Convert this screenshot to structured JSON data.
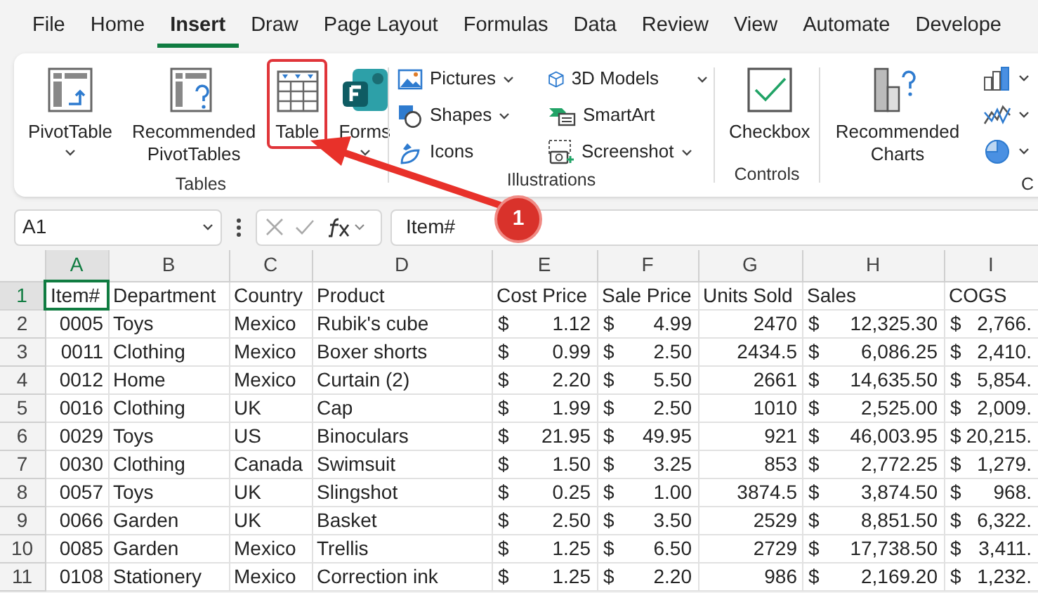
{
  "ribbon_tabs": [
    {
      "label": "File",
      "selected": false
    },
    {
      "label": "Home",
      "selected": false
    },
    {
      "label": "Insert",
      "selected": true
    },
    {
      "label": "Draw",
      "selected": false
    },
    {
      "label": "Page Layout",
      "selected": false
    },
    {
      "label": "Formulas",
      "selected": false
    },
    {
      "label": "Data",
      "selected": false
    },
    {
      "label": "Review",
      "selected": false
    },
    {
      "label": "View",
      "selected": false
    },
    {
      "label": "Automate",
      "selected": false
    },
    {
      "label": "Develope",
      "selected": false
    }
  ],
  "ribbon_groups": [
    {
      "label": "Tables",
      "buttons": [
        {
          "kind": "large",
          "label": "PivotTable",
          "dropdown": true,
          "highlighted": false
        },
        {
          "kind": "large",
          "label": "Recommended PivotTables",
          "dropdown": false,
          "highlighted": false
        },
        {
          "kind": "large",
          "label": "Table",
          "dropdown": false,
          "highlighted": true
        },
        {
          "kind": "large",
          "label": "Forms",
          "dropdown": true,
          "highlighted": false
        }
      ]
    },
    {
      "label": "Illustrations",
      "buttons": [
        {
          "kind": "small",
          "label": "Pictures",
          "dropdown": true,
          "highlighted": false
        },
        {
          "kind": "small",
          "label": "Shapes",
          "dropdown": true,
          "highlighted": false
        },
        {
          "kind": "small",
          "label": "Icons",
          "dropdown": false,
          "highlighted": false
        },
        {
          "kind": "small",
          "label": "3D Models",
          "dropdown": true,
          "highlighted": false
        },
        {
          "kind": "small",
          "label": "SmartArt",
          "dropdown": false,
          "highlighted": false
        },
        {
          "kind": "small",
          "label": "Screenshot",
          "dropdown": true,
          "highlighted": false
        }
      ]
    },
    {
      "label": "Controls",
      "buttons": [
        {
          "kind": "large",
          "label": "Checkbox",
          "dropdown": false,
          "highlighted": false
        }
      ]
    },
    {
      "label": "C",
      "buttons": [
        {
          "kind": "large",
          "label": "Recommended Charts",
          "dropdown": false,
          "highlighted": false
        },
        {
          "kind": "icon",
          "dropdown": true,
          "highlighted": false
        },
        {
          "kind": "icon",
          "dropdown": true,
          "highlighted": false
        },
        {
          "kind": "icon",
          "dropdown": true,
          "highlighted": false
        }
      ]
    }
  ],
  "formula_bar": {
    "name_box": "A1",
    "formula": "Item#"
  },
  "callout": {
    "label": "1"
  },
  "columns": [
    {
      "letter": "A",
      "kind": "number",
      "selected": true
    },
    {
      "letter": "B",
      "kind": "text",
      "selected": false
    },
    {
      "letter": "C",
      "kind": "text",
      "selected": false
    },
    {
      "letter": "D",
      "kind": "text",
      "selected": false
    },
    {
      "letter": "E",
      "kind": "currency",
      "selected": false
    },
    {
      "letter": "F",
      "kind": "currency",
      "selected": false
    },
    {
      "letter": "G",
      "kind": "number",
      "selected": false
    },
    {
      "letter": "H",
      "kind": "currency",
      "selected": false
    },
    {
      "letter": "I",
      "kind": "currency",
      "selected": false
    }
  ],
  "rows": [
    {
      "number": "1",
      "selected": true,
      "cells": [
        "Item#",
        "Department",
        "Country",
        "Product",
        "Cost Price",
        "Sale Price",
        "Units Sold",
        "Sales",
        "COGS"
      ]
    },
    {
      "number": "2",
      "selected": false,
      "cells": [
        "0005",
        "Toys",
        "Mexico",
        "Rubik's cube",
        {
          "symbol": "$",
          "amount": "1.12"
        },
        {
          "symbol": "$",
          "amount": "4.99"
        },
        "2470",
        {
          "symbol": "$",
          "amount": "12,325.30"
        },
        {
          "symbol": "$",
          "amount": "2,766."
        }
      ]
    },
    {
      "number": "3",
      "selected": false,
      "cells": [
        "0011",
        "Clothing",
        "Mexico",
        "Boxer shorts",
        {
          "symbol": "$",
          "amount": "0.99"
        },
        {
          "symbol": "$",
          "amount": "2.50"
        },
        "2434.5",
        {
          "symbol": "$",
          "amount": "6,086.25"
        },
        {
          "symbol": "$",
          "amount": "2,410."
        }
      ]
    },
    {
      "number": "4",
      "selected": false,
      "cells": [
        "0012",
        "Home",
        "Mexico",
        "Curtain (2)",
        {
          "symbol": "$",
          "amount": "2.20"
        },
        {
          "symbol": "$",
          "amount": "5.50"
        },
        "2661",
        {
          "symbol": "$",
          "amount": "14,635.50"
        },
        {
          "symbol": "$",
          "amount": "5,854."
        }
      ]
    },
    {
      "number": "5",
      "selected": false,
      "cells": [
        "0016",
        "Clothing",
        "UK",
        "Cap",
        {
          "symbol": "$",
          "amount": "1.99"
        },
        {
          "symbol": "$",
          "amount": "2.50"
        },
        "1010",
        {
          "symbol": "$",
          "amount": "2,525.00"
        },
        {
          "symbol": "$",
          "amount": "2,009."
        }
      ]
    },
    {
      "number": "6",
      "selected": false,
      "cells": [
        "0029",
        "Toys",
        "US",
        "Binoculars",
        {
          "symbol": "$",
          "amount": "21.95"
        },
        {
          "symbol": "$",
          "amount": "49.95"
        },
        "921",
        {
          "symbol": "$",
          "amount": "46,003.95"
        },
        {
          "symbol": "$",
          "amount": "20,215."
        }
      ]
    },
    {
      "number": "7",
      "selected": false,
      "cells": [
        "0030",
        "Clothing",
        "Canada",
        "Swimsuit",
        {
          "symbol": "$",
          "amount": "1.50"
        },
        {
          "symbol": "$",
          "amount": "3.25"
        },
        "853",
        {
          "symbol": "$",
          "amount": "2,772.25"
        },
        {
          "symbol": "$",
          "amount": "1,279."
        }
      ]
    },
    {
      "number": "8",
      "selected": false,
      "cells": [
        "0057",
        "Toys",
        "UK",
        "Slingshot",
        {
          "symbol": "$",
          "amount": "0.25"
        },
        {
          "symbol": "$",
          "amount": "1.00"
        },
        "3874.5",
        {
          "symbol": "$",
          "amount": "3,874.50"
        },
        {
          "symbol": "$",
          "amount": "968."
        }
      ]
    },
    {
      "number": "9",
      "selected": false,
      "cells": [
        "0066",
        "Garden",
        "UK",
        "Basket",
        {
          "symbol": "$",
          "amount": "2.50"
        },
        {
          "symbol": "$",
          "amount": "3.50"
        },
        "2529",
        {
          "symbol": "$",
          "amount": "8,851.50"
        },
        {
          "symbol": "$",
          "amount": "6,322."
        }
      ]
    },
    {
      "number": "10",
      "selected": false,
      "cells": [
        "0085",
        "Garden",
        "Mexico",
        "Trellis",
        {
          "symbol": "$",
          "amount": "1.25"
        },
        {
          "symbol": "$",
          "amount": "6.50"
        },
        "2729",
        {
          "symbol": "$",
          "amount": "17,738.50"
        },
        {
          "symbol": "$",
          "amount": "3,411."
        }
      ]
    },
    {
      "number": "11",
      "selected": false,
      "cells": [
        "0108",
        "Stationery",
        "Mexico",
        "Correction ink",
        {
          "symbol": "$",
          "amount": "1.25"
        },
        {
          "symbol": "$",
          "amount": "2.20"
        },
        "986",
        {
          "symbol": "$",
          "amount": "2,169.20"
        },
        {
          "symbol": "$",
          "amount": "1,232."
        }
      ]
    }
  ]
}
